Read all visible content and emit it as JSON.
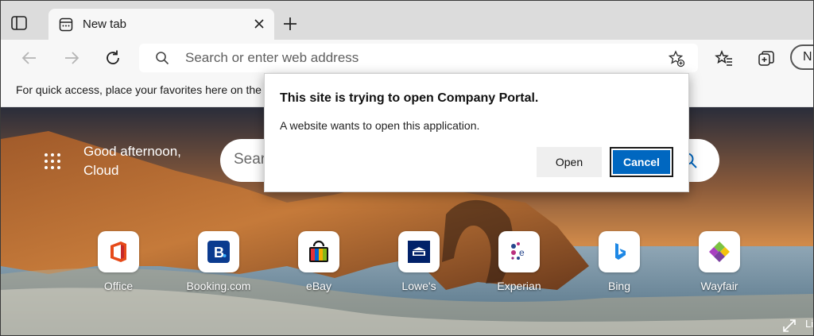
{
  "browser": {
    "tab": {
      "title": "New tab"
    },
    "address_bar": {
      "placeholder": "Search or enter web address"
    },
    "profile_initial": "N",
    "favorites_bar_text": "For quick access, place your favorites here on the"
  },
  "new_tab_page": {
    "greeting_line1": "Good afternoon,",
    "greeting_line2": "Cloud",
    "search_placeholder": "Sear",
    "tiles": [
      {
        "label": "Office",
        "icon": "office-icon"
      },
      {
        "label": "Booking.com",
        "icon": "booking-icon"
      },
      {
        "label": "eBay",
        "icon": "ebay-icon"
      },
      {
        "label": "Lowe's",
        "icon": "lowes-icon"
      },
      {
        "label": "Experian",
        "icon": "experian-icon"
      },
      {
        "label": "Bing",
        "icon": "bing-icon"
      },
      {
        "label": "Wayfair",
        "icon": "wayfair-icon"
      }
    ],
    "expand_label": "Li"
  },
  "dialog": {
    "title": "This site is trying to open Company Portal.",
    "message": "A website wants to open this application.",
    "open_label": "Open",
    "cancel_label": "Cancel"
  },
  "colors": {
    "accent_blue": "#0067c0",
    "toolbar_bg": "#f7f7f7",
    "tabstrip_bg": "#dcdcdc"
  }
}
